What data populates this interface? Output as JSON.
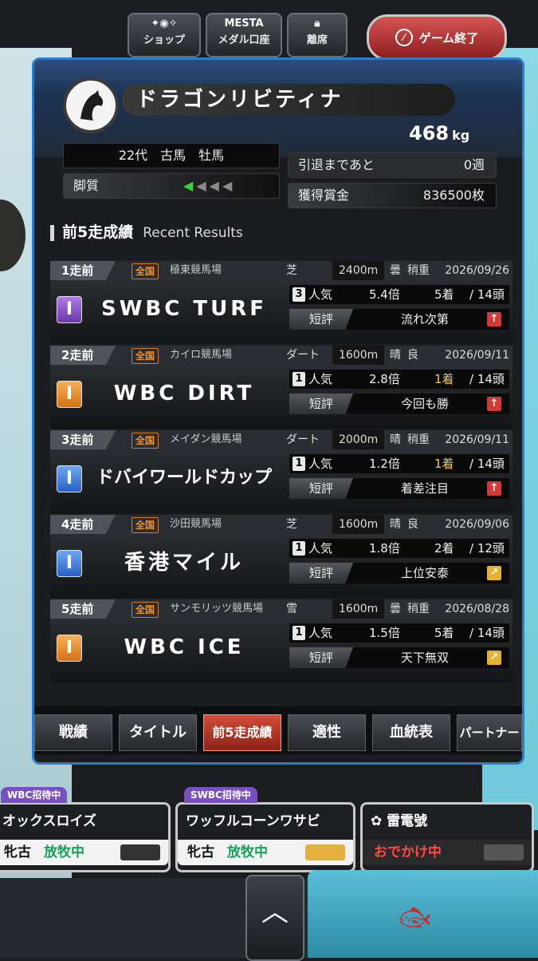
{
  "toolbar": {
    "shop": "ショップ",
    "medal_account": "メダル口座",
    "medal_logo": "MESTA",
    "leave_seat": "離席",
    "end_game": "ゲーム終了"
  },
  "horse": {
    "name": "ドラゴンリビティナ",
    "weight": "468",
    "weight_unit": "kg",
    "generation": "22代　古馬　牡馬",
    "legs_label": "脚質",
    "legs_level": 1,
    "retire_label": "引退まであと",
    "retire_value": "0週",
    "prize_label": "獲得賞金",
    "prize_value": "836500枚"
  },
  "section": {
    "title": "前5走成績",
    "title_en": "Recent Results"
  },
  "races": [
    {
      "ago": "1走前",
      "scope": "全国",
      "course": "極東競馬場",
      "surface": "芝",
      "distance": "2400m",
      "weather": "曇",
      "condition": "稍重",
      "date": "2026/09/26",
      "grade": "I",
      "grade_color": "#7b4cc2",
      "name": "SWBC TURF",
      "pop": "3",
      "pop_label": "人気",
      "odds": "5.4倍",
      "place": "5着",
      "of": "/ 14頭",
      "comment_label": "短評",
      "comment": "流れ次第",
      "arrow": "up"
    },
    {
      "ago": "2走前",
      "scope": "全国",
      "course": "カイロ競馬場",
      "surface": "ダート",
      "distance": "1600m",
      "weather": "晴",
      "condition": "良",
      "date": "2026/09/11",
      "grade": "I",
      "grade_color": "#e0872a",
      "name": "WBC DIRT",
      "pop": "1",
      "pop_label": "人気",
      "odds": "2.8倍",
      "place": "1着",
      "of": "/ 14頭",
      "comment_label": "短評",
      "comment": "今回も勝",
      "arrow": "up"
    },
    {
      "ago": "3走前",
      "scope": "全国",
      "course": "メイダン競馬場",
      "surface": "ダート",
      "distance": "2000m",
      "weather": "晴",
      "condition": "稍重",
      "date": "2026/09/11",
      "grade": "I",
      "grade_color": "#3a73d8",
      "name": "ドバイワールドカップ",
      "pop": "1",
      "pop_label": "人気",
      "odds": "1.2倍",
      "place": "1着",
      "of": "/ 14頭",
      "comment_label": "短評",
      "comment": "着差注目",
      "arrow": "up"
    },
    {
      "ago": "4走前",
      "scope": "全国",
      "course": "沙田競馬場",
      "surface": "芝",
      "distance": "1600m",
      "weather": "晴",
      "condition": "良",
      "date": "2026/09/06",
      "grade": "I",
      "grade_color": "#3a73d8",
      "name": "香港マイル",
      "pop": "1",
      "pop_label": "人気",
      "odds": "1.8倍",
      "place": "2着",
      "of": "/ 12頭",
      "comment_label": "短評",
      "comment": "上位安泰",
      "arrow": "diag"
    },
    {
      "ago": "5走前",
      "scope": "全国",
      "course": "サンモリッツ競馬場",
      "surface": "雪",
      "distance": "1600m",
      "weather": "曇",
      "condition": "稍重",
      "date": "2026/08/28",
      "grade": "I",
      "grade_color": "#e0872a",
      "name": "WBC ICE",
      "pop": "1",
      "pop_label": "人気",
      "odds": "1.5倍",
      "place": "5着",
      "of": "/ 14頭",
      "comment_label": "短評",
      "comment": "天下無双",
      "arrow": "diag"
    }
  ],
  "tabs": [
    "戦績",
    "タイトル",
    "前5走成績",
    "適性",
    "血統表",
    "パートナー"
  ],
  "active_tab": "前5走成績",
  "cards": [
    {
      "ribbon": "WBC招待中",
      "name": "オックスロイズ",
      "k": "牝古",
      "v": "放牧中"
    },
    {
      "ribbon": "SWBC招待中",
      "name": "ワッフルコーンワサビ",
      "k": "牝古",
      "v": "放牧中"
    },
    {
      "ribbon": "",
      "name": "雷電號",
      "k": "",
      "v": "おでかけ中"
    }
  ]
}
